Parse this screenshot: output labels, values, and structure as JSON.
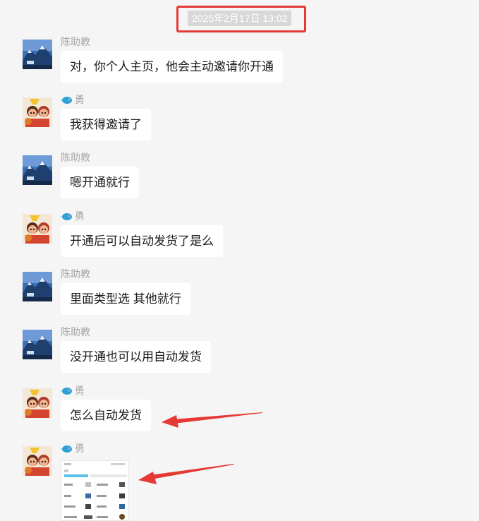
{
  "timestamp": "2025年2月17日 13:02",
  "messages": [
    {
      "sender": "陈助教",
      "text": "对，你个人主页，他会主动邀请你开通"
    },
    {
      "sender": "勇",
      "text": "我获得邀请了"
    },
    {
      "sender": "陈助教",
      "text": "嗯开通就行"
    },
    {
      "sender": "勇",
      "text": "开通后可以自动发货了是么"
    },
    {
      "sender": "陈助教",
      "text": "里面类型选 其他就行"
    },
    {
      "sender": "陈助教",
      "text": "没开通也可以用自动发货"
    },
    {
      "sender": "勇",
      "text": "怎么自动发货"
    },
    {
      "sender": "勇",
      "image": "screenshot-thumbnail"
    }
  ],
  "colors": {
    "background": "#f5f5f5",
    "bubble": "#ffffff",
    "highlight_red": "#e53935",
    "sender_gray": "#a6a6a6",
    "timestamp_bg": "#d8d8d8"
  },
  "icons": {
    "assistant_avatar": "mountain-landscape-avatar",
    "user_avatar": "cartoon-characters-avatar",
    "user_name_prefix": "fish-icon"
  }
}
